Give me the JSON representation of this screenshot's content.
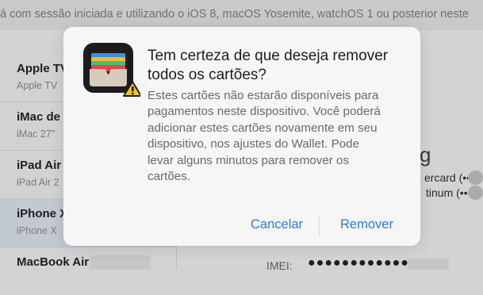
{
  "background": {
    "top_notice": "á com sessão iniciada e utilizando o iOS 8, macOS Yosemite, watchOS 1 ou posterior neste",
    "devices": [
      {
        "name": "Apple TV",
        "model": "Apple TV"
      },
      {
        "name": "iMac de",
        "model": "iMac 27\""
      },
      {
        "name": "iPad Air",
        "model": "iPad Air 2"
      },
      {
        "name": "iPhone X",
        "model": "iPhone X"
      },
      {
        "name": "MacBook Air",
        "model": ""
      }
    ],
    "right_heading_fragment": "g",
    "card_line_1": "ercard (••••",
    "card_line_2": "tinum (••••",
    "imei_label": "IMEI:",
    "imei_value": "●●●●●●●●●●●●●"
  },
  "dialog": {
    "title": "Tem certeza de que deseja remover todos os cartões?",
    "message": "Estes cartões não estarão disponíveis para pagamentos neste dispositivo. Você poderá adicionar estes cartões novamente em seu dispositivo, nos ajustes do Wallet. Pode levar alguns minutos para remover os cartões.",
    "cancel_label": "Cancelar",
    "remove_label": "Remover",
    "icon_name": "wallet-warning-icon"
  },
  "colors": {
    "button_blue": "#2e7bd6",
    "warning_yellow": "#f5c518"
  }
}
